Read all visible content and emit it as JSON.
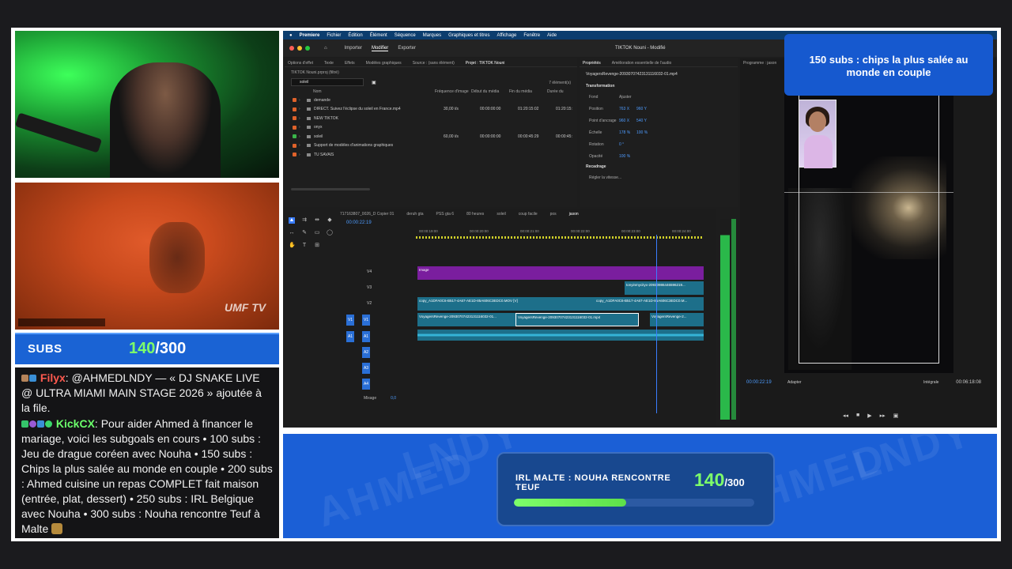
{
  "subs_widget": {
    "label": "SUBS",
    "current": "140",
    "total": "/300"
  },
  "chat": [
    {
      "user": "Filyx",
      "text": ": @AHMEDLNDY — « DJ SNAKE LIVE @ ULTRA MIAMI MAIN STAGE 2026 » ajoutée à la file."
    },
    {
      "user": "KickCX",
      "text": ":  Pour aider Ahmed à financer le mariage, voici les subgoals en cours • 100 subs : Jeu de drague coréen avec Nouha • 150 subs : Chips la plus salée au monde en couple • 200 subs : Ahmed cuisine un repas COMPLET fait maison (entrée, plat, dessert) • 250 subs : IRL Belgique avec Nouha • 300 subs : Nouha rencontre Teuf à Malte"
    }
  ],
  "concert": {
    "logo": "UMF TV"
  },
  "premiere": {
    "menu": [
      "Premiere",
      "Fichier",
      "Édition",
      "Élément",
      "Séquence",
      "Marques",
      "Graphiques et titres",
      "Affichage",
      "Fenêtre",
      "Aide"
    ],
    "workspace_tabs": [
      "Importer",
      "Modifier",
      "Exporter"
    ],
    "doc_title": "TIKTOK Nouni - Modifié",
    "project_tabs": [
      "Options d'effet",
      "Texte",
      "Effets",
      "Modèles graphiques",
      "Source : (sans élément)",
      "Projet : TIKTOK Nouni"
    ],
    "project_path": "TIKTOK Nouni.prproj (filtré)",
    "search_value": "soleil",
    "item_count": "7 élément(s)",
    "columns": [
      "Nom",
      "Fréquence d'image",
      "Début du média",
      "Fin du média",
      "Durée du"
    ],
    "files": [
      {
        "name": "demande",
        "rate": "",
        "start": "",
        "end": "",
        "dur": "",
        "color": "#e0622a"
      },
      {
        "name": "DIRECT. Suivez l'éclipse du soleil en France.mp4",
        "rate": "30,00 i/s",
        "start": "00:00:00:00",
        "end": "01:20:15:02",
        "dur": "01:20:15:",
        "color": "#e0622a"
      },
      {
        "name": "NEW TIKTOK",
        "rate": "",
        "start": "",
        "end": "",
        "dur": "",
        "color": "#e0622a"
      },
      {
        "name": "onyx",
        "rate": "",
        "start": "",
        "end": "",
        "dur": "",
        "color": "#e0622a"
      },
      {
        "name": "soleil",
        "rate": "60,00 i/s",
        "start": "00:00:00:00",
        "end": "00:00:45:29",
        "dur": "00:00:45:",
        "color": "#3ab54a"
      },
      {
        "name": "Support de modèles d'animations graphiques",
        "rate": "",
        "start": "",
        "end": "",
        "dur": "",
        "color": "#e0622a"
      },
      {
        "name": "TU SAVAIS",
        "rate": "",
        "start": "",
        "end": "",
        "dur": "",
        "color": "#e0622a"
      }
    ],
    "props_tabs": [
      "Propriétés",
      "Amélioration essentielle de l'audio"
    ],
    "props_file": "VoyagersRevenge-20930707423131116032-01.mp4",
    "transform_label": "Transformation",
    "fill_label": "Fond",
    "fit_label": "Ajuster",
    "properties": [
      {
        "k": "Position",
        "v1": "763 X",
        "v2": "960 Y"
      },
      {
        "k": "Point d'ancrage",
        "v1": "960 X",
        "v2": "540 Y"
      },
      {
        "k": "Échelle",
        "v1": "178 %",
        "v2": "100 %"
      },
      {
        "k": "Rotation",
        "v1": "0 °",
        "v2": ""
      },
      {
        "k": "Opacité",
        "v1": "100 %",
        "v2": ""
      }
    ],
    "crop_label": "Recadrage",
    "speed_label": "Régler la vitesse...",
    "program_label": "Programme : jason",
    "program_tc": "00:00:22:19",
    "program_end": "00:06:18:08",
    "zoom": "Adapter",
    "quality": "Intégrale",
    "seq_tabs": [
      "717163807_0026_D Copier 01",
      "deruh gta",
      "PSS gta 6",
      "80 heures",
      "soleil",
      "coup facile",
      "pos",
      "jason"
    ],
    "timeline_tc": "00:00:22:19",
    "ruler": [
      "00:00:19:00",
      "00:00:20:00",
      "00:00:21:00",
      "00:00:22:00",
      "00:00:23:00",
      "00:00:24:00"
    ],
    "tracks": [
      "V4",
      "V3",
      "V2",
      "V1",
      "A1",
      "A2",
      "A3",
      "A4"
    ],
    "clips": {
      "v4": "Image",
      "v3": "tonyinmycityx-20930986446596219...",
      "v2a": "copy_A1DFA0C6-B517-4A67-AE1D-85A606C3EDC0.MOV [V]",
      "v2b": "copy_A1DFA0C6-B517-4A67-AE1D-85A606C3EDC0.M...",
      "v1a": "VoyagersRevenge-20930707423131116032-01...",
      "v1b": "VoyagersRevenge-20930707423131116032-01.mp4",
      "v1c": "VoyagersRevenge-2..."
    },
    "mix_label": "Mixage",
    "mix_value": "0,0"
  },
  "program_banner": "150 subs : chips la plus salée au monde en couple",
  "goal": {
    "title": "IRL MALTE : NOUHA RENCONTRE TEUF",
    "current": "140",
    "total": "/300",
    "progress": 0.4667
  },
  "watermark": [
    "AHMED",
    "LNDY"
  ],
  "colors": {
    "accent": "#1b5fd6",
    "green": "#7dff6a",
    "premiere_blue": "#4e9cff"
  }
}
